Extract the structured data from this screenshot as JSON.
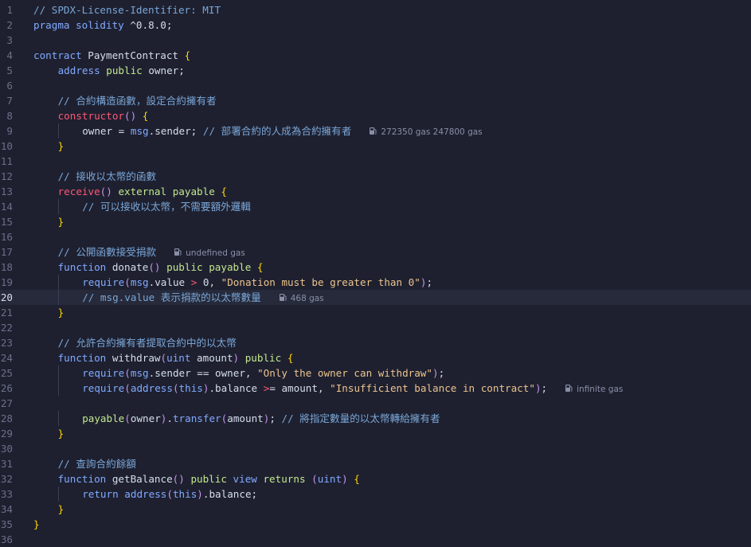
{
  "editor": {
    "language": "solidity",
    "current_line": 20,
    "colors": {
      "background": "#1e2030",
      "current_line": "#262a3b",
      "line_number": "#6b7089",
      "comment": "#7aa6d6",
      "keyword": "#c58cf0",
      "string": "#ecc48d"
    },
    "lines": [
      {
        "n": "1",
        "indent": 0,
        "tokens": [
          [
            "t-comment",
            "// SPDX-License-Identifier: MIT"
          ]
        ]
      },
      {
        "n": "2",
        "indent": 0,
        "tokens": [
          [
            "t-kw2",
            "pragma"
          ],
          [
            "t-plain",
            " "
          ],
          [
            "t-kw2",
            "solidity"
          ],
          [
            "t-plain",
            " ^0.8.0;"
          ]
        ]
      },
      {
        "n": "3",
        "indent": 0,
        "tokens": []
      },
      {
        "n": "4",
        "indent": 0,
        "tokens": [
          [
            "t-kw2",
            "contract"
          ],
          [
            "t-plain",
            " PaymentContract "
          ],
          [
            "t-brace",
            "{"
          ]
        ]
      },
      {
        "n": "5",
        "indent": 1,
        "tokens": [
          [
            "t-kw2",
            "address"
          ],
          [
            "t-plain",
            " "
          ],
          [
            "t-type",
            "public"
          ],
          [
            "t-plain",
            " owner;"
          ]
        ]
      },
      {
        "n": "6",
        "indent": 0,
        "tokens": []
      },
      {
        "n": "7",
        "indent": 1,
        "tokens": [
          [
            "t-comment",
            "// 合約構造函數，設定合約擁有者"
          ]
        ]
      },
      {
        "n": "8",
        "indent": 1,
        "tokens": [
          [
            "t-op",
            "constructor"
          ],
          [
            "t-paren",
            "()"
          ],
          [
            "t-plain",
            " "
          ],
          [
            "t-brace",
            "{"
          ]
        ]
      },
      {
        "n": "9",
        "indent": 2,
        "tokens": [
          [
            "t-plain",
            "owner = "
          ],
          [
            "t-kw2",
            "msg"
          ],
          [
            "t-plain",
            ".sender; "
          ],
          [
            "t-comment",
            "// 部署合約的人成為合約擁有者"
          ]
        ],
        "hint": "272350 gas 247800 gas"
      },
      {
        "n": "10",
        "indent": 1,
        "tokens": [
          [
            "t-brace",
            "}"
          ]
        ]
      },
      {
        "n": "11",
        "indent": 0,
        "tokens": []
      },
      {
        "n": "12",
        "indent": 1,
        "tokens": [
          [
            "t-comment",
            "// 接收以太幣的函數"
          ]
        ]
      },
      {
        "n": "13",
        "indent": 1,
        "tokens": [
          [
            "t-op",
            "receive"
          ],
          [
            "t-paren",
            "()"
          ],
          [
            "t-plain",
            " "
          ],
          [
            "t-type",
            "external"
          ],
          [
            "t-plain",
            " "
          ],
          [
            "t-type",
            "payable"
          ],
          [
            "t-plain",
            " "
          ],
          [
            "t-brace",
            "{"
          ]
        ]
      },
      {
        "n": "14",
        "indent": 2,
        "tokens": [
          [
            "t-comment",
            "// 可以接收以太幣，不需要額外邏輯"
          ]
        ]
      },
      {
        "n": "15",
        "indent": 1,
        "tokens": [
          [
            "t-brace",
            "}"
          ]
        ]
      },
      {
        "n": "16",
        "indent": 0,
        "tokens": []
      },
      {
        "n": "17",
        "indent": 1,
        "tokens": [
          [
            "t-comment",
            "// 公開函數接受捐款"
          ]
        ],
        "hint": "undefined gas"
      },
      {
        "n": "18",
        "indent": 1,
        "tokens": [
          [
            "t-kw2",
            "function"
          ],
          [
            "t-plain",
            " donate"
          ],
          [
            "t-paren",
            "()"
          ],
          [
            "t-plain",
            " "
          ],
          [
            "t-type",
            "public"
          ],
          [
            "t-plain",
            " "
          ],
          [
            "t-type",
            "payable"
          ],
          [
            "t-plain",
            " "
          ],
          [
            "t-brace",
            "{"
          ]
        ]
      },
      {
        "n": "19",
        "indent": 2,
        "tokens": [
          [
            "t-kw2",
            "require"
          ],
          [
            "t-paren",
            "("
          ],
          [
            "t-kw2",
            "msg"
          ],
          [
            "t-plain",
            ".value "
          ],
          [
            "t-op",
            ">"
          ],
          [
            "t-plain",
            " 0, "
          ],
          [
            "t-str",
            "\"Donation must be greater than 0\""
          ],
          [
            "t-paren",
            ")"
          ],
          [
            "t-plain",
            ";"
          ]
        ]
      },
      {
        "n": "20",
        "indent": 2,
        "tokens": [
          [
            "t-comment",
            "// msg.value 表示捐款的以太幣數量"
          ]
        ],
        "hint": "468 gas"
      },
      {
        "n": "21",
        "indent": 1,
        "tokens": [
          [
            "t-brace",
            "}"
          ]
        ]
      },
      {
        "n": "22",
        "indent": 0,
        "tokens": []
      },
      {
        "n": "23",
        "indent": 1,
        "tokens": [
          [
            "t-comment",
            "// 允許合約擁有者提取合約中的以太幣"
          ]
        ]
      },
      {
        "n": "24",
        "indent": 1,
        "tokens": [
          [
            "t-kw2",
            "function"
          ],
          [
            "t-plain",
            " withdraw"
          ],
          [
            "t-paren",
            "("
          ],
          [
            "t-kw2",
            "uint"
          ],
          [
            "t-plain",
            " amount"
          ],
          [
            "t-paren",
            ")"
          ],
          [
            "t-plain",
            " "
          ],
          [
            "t-type",
            "public"
          ],
          [
            "t-plain",
            " "
          ],
          [
            "t-brace",
            "{"
          ]
        ]
      },
      {
        "n": "25",
        "indent": 2,
        "tokens": [
          [
            "t-kw2",
            "require"
          ],
          [
            "t-paren",
            "("
          ],
          [
            "t-kw2",
            "msg"
          ],
          [
            "t-plain",
            ".sender == owner, "
          ],
          [
            "t-str",
            "\"Only the owner can withdraw\""
          ],
          [
            "t-paren",
            ")"
          ],
          [
            "t-plain",
            ";"
          ]
        ]
      },
      {
        "n": "26",
        "indent": 2,
        "tokens": [
          [
            "t-kw2",
            "require"
          ],
          [
            "t-paren",
            "("
          ],
          [
            "t-kw2",
            "address"
          ],
          [
            "t-paren",
            "("
          ],
          [
            "t-kw2",
            "this"
          ],
          [
            "t-paren",
            ")"
          ],
          [
            "t-plain",
            ".balance "
          ],
          [
            "t-op",
            ">"
          ],
          [
            "t-plain",
            "= amount, "
          ],
          [
            "t-str",
            "\"Insufficient balance in contract\""
          ],
          [
            "t-paren",
            ")"
          ],
          [
            "t-plain",
            ";"
          ]
        ],
        "hint": "infinite gas"
      },
      {
        "n": "27",
        "indent": 0,
        "tokens": []
      },
      {
        "n": "28",
        "indent": 2,
        "tokens": [
          [
            "t-type",
            "payable"
          ],
          [
            "t-paren",
            "("
          ],
          [
            "t-plain",
            "owner"
          ],
          [
            "t-paren",
            ")"
          ],
          [
            "t-plain",
            "."
          ],
          [
            "t-kw2",
            "transfer"
          ],
          [
            "t-paren",
            "("
          ],
          [
            "t-plain",
            "amount"
          ],
          [
            "t-paren",
            ")"
          ],
          [
            "t-plain",
            "; "
          ],
          [
            "t-comment",
            "// 將指定數量的以太幣轉給擁有者"
          ]
        ]
      },
      {
        "n": "29",
        "indent": 1,
        "tokens": [
          [
            "t-brace",
            "}"
          ]
        ]
      },
      {
        "n": "30",
        "indent": 0,
        "tokens": []
      },
      {
        "n": "31",
        "indent": 1,
        "tokens": [
          [
            "t-comment",
            "// 查詢合約餘額"
          ]
        ]
      },
      {
        "n": "32",
        "indent": 1,
        "tokens": [
          [
            "t-kw2",
            "function"
          ],
          [
            "t-plain",
            " getBalance"
          ],
          [
            "t-paren",
            "()"
          ],
          [
            "t-plain",
            " "
          ],
          [
            "t-type",
            "public"
          ],
          [
            "t-plain",
            " "
          ],
          [
            "t-kw2",
            "view"
          ],
          [
            "t-plain",
            " "
          ],
          [
            "t-type",
            "returns"
          ],
          [
            "t-plain",
            " "
          ],
          [
            "t-paren",
            "("
          ],
          [
            "t-kw2",
            "uint"
          ],
          [
            "t-paren",
            ")"
          ],
          [
            "t-plain",
            " "
          ],
          [
            "t-brace",
            "{"
          ]
        ]
      },
      {
        "n": "33",
        "indent": 2,
        "tokens": [
          [
            "t-kw2",
            "return"
          ],
          [
            "t-plain",
            " "
          ],
          [
            "t-kw2",
            "address"
          ],
          [
            "t-paren",
            "("
          ],
          [
            "t-kw2",
            "this"
          ],
          [
            "t-paren",
            ")"
          ],
          [
            "t-plain",
            ".balance;"
          ]
        ]
      },
      {
        "n": "34",
        "indent": 1,
        "tokens": [
          [
            "t-brace",
            "}"
          ]
        ]
      },
      {
        "n": "35",
        "indent": 0,
        "tokens": [
          [
            "t-brace",
            "}"
          ]
        ]
      },
      {
        "n": "36",
        "indent": 0,
        "tokens": []
      }
    ]
  }
}
